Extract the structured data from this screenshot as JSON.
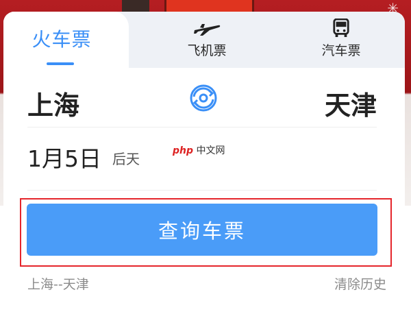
{
  "tabs": {
    "active": "火车票",
    "items": [
      {
        "label": "飞机票",
        "icon": "airplane-icon"
      },
      {
        "label": "汽车票",
        "icon": "bus-icon"
      }
    ]
  },
  "route": {
    "from": "上海",
    "to": "天津",
    "swap_icon": "swap-icon"
  },
  "date": {
    "value": "1月5日",
    "relative": "后天"
  },
  "watermark": {
    "brand": "php",
    "site": "中文网"
  },
  "actions": {
    "search_label": "查询车票"
  },
  "history": {
    "recent": "上海--天津",
    "clear_label": "清除历史"
  },
  "colors": {
    "accent": "#3a8ff7",
    "button": "#4a9cf8",
    "highlight": "#e5252b"
  }
}
